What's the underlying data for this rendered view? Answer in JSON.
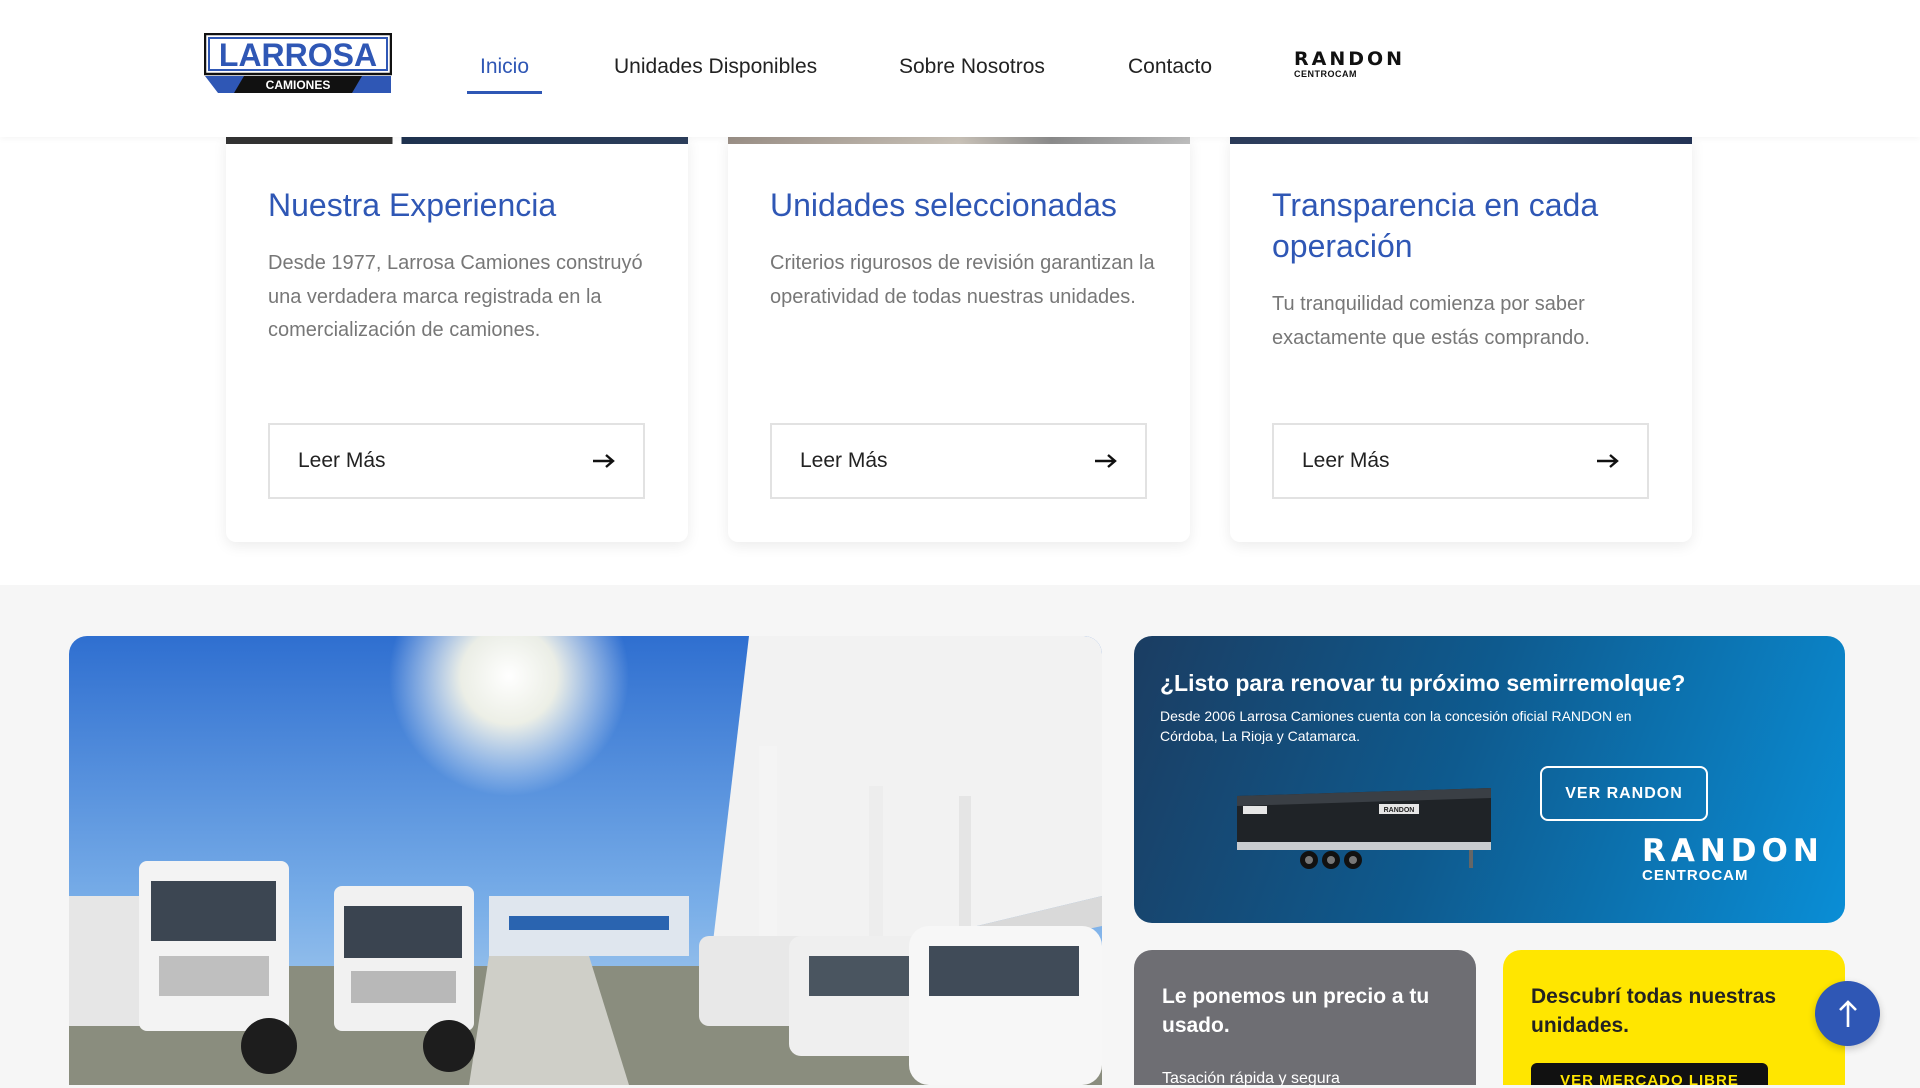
{
  "header": {
    "logo": {
      "main": "LARROSA",
      "sub": "CAMIONES"
    },
    "nav": [
      {
        "label": "Inicio",
        "active": true
      },
      {
        "label": "Unidades Disponibles",
        "active": false
      },
      {
        "label": "Sobre Nosotros",
        "active": false
      },
      {
        "label": "Contacto",
        "active": false
      }
    ],
    "randon": {
      "word": "RANDON",
      "sub": "CENTROCAM"
    }
  },
  "cards": [
    {
      "title": "Nuestra Experiencia",
      "text": "Desde 1977, Larrosa Camiones construyó una verdadera marca registrada en la comercialización de camiones.",
      "button": "Leer Más"
    },
    {
      "title": "Unidades seleccionadas",
      "text": "Criterios rigurosos de revisión garantizan la operatividad de todas nuestras unidades.",
      "button": "Leer Más"
    },
    {
      "title": "Transparencia en cada operación",
      "text": "Tu tranquilidad comienza por saber exactamente que estás comprando.",
      "button": "Leer Más"
    }
  ],
  "promo": {
    "title": "¿Listo para renovar tu próximo semirremolque?",
    "text": "Desde 2006 Larrosa Camiones cuenta con la concesión oficial RANDON en Córdoba, La Rioja y Catamarca.",
    "button": "VER RANDON",
    "brand": {
      "word": "RANDON",
      "sub": "CENTROCAM"
    },
    "trailer_label": "RANDON"
  },
  "used": {
    "title": "Le ponemos un precio a tu usado.",
    "sub": "Tasación rápida y segura"
  },
  "units": {
    "title": "Descubrí todas nuestras unidades.",
    "button": "VER MERCADO LIBRE"
  },
  "scroll_top": {
    "icon": "arrow-up-icon",
    "glyph": "↑"
  },
  "colors": {
    "brand_blue": "#2f57b5",
    "yellow": "#ffe600",
    "grey": "#6e6e73"
  }
}
